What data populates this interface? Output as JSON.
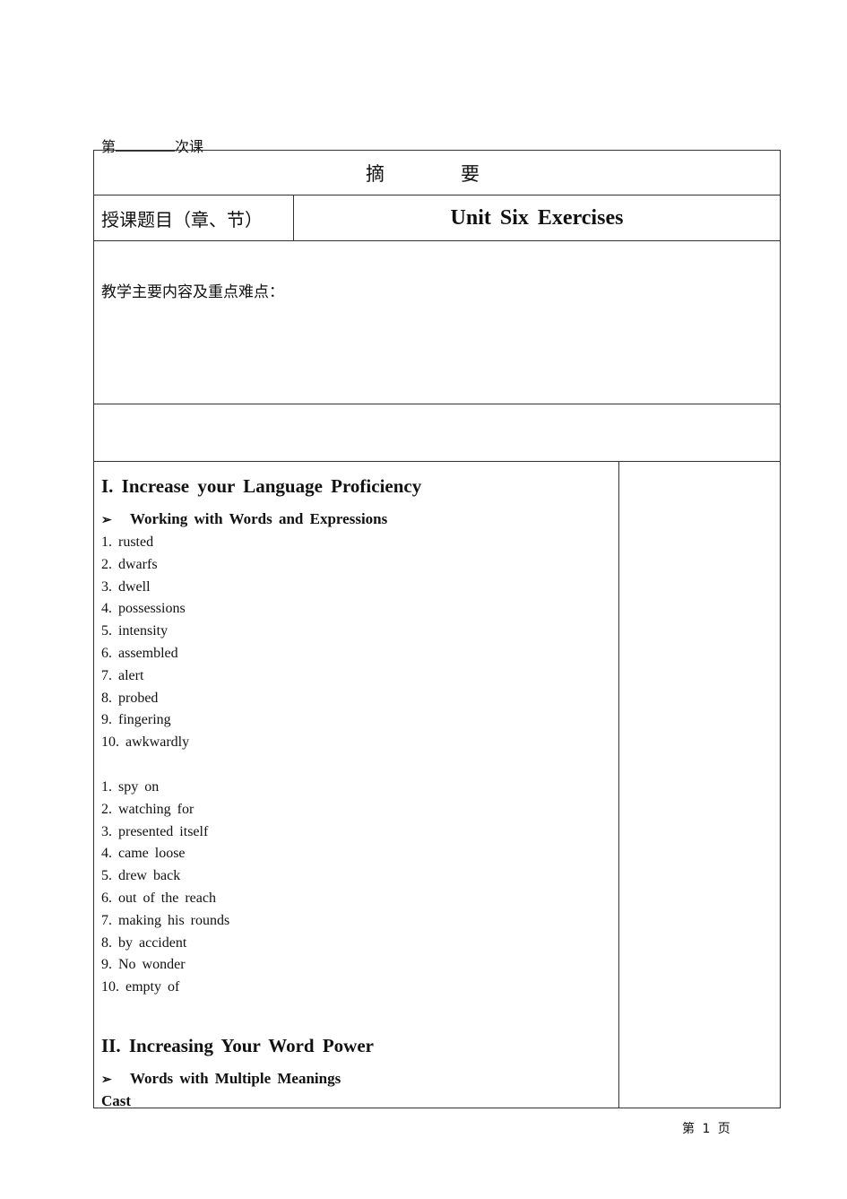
{
  "lesson": {
    "prefix": "第",
    "suffix": "次课"
  },
  "table": {
    "title": "摘　要",
    "topic_label": "授课题目（章、节）",
    "topic_value": "Unit Six Exercises",
    "content_label": "教学主要内容及重点难点："
  },
  "section1": {
    "heading": "I. Increase your Language Proficiency",
    "subheading": "Working with Words and Expressions",
    "words": [
      "1. rusted",
      "2. dwarfs",
      "3. dwell",
      "4. possessions",
      "5. intensity",
      "6. assembled",
      "7. alert",
      "8. probed",
      "9. fingering",
      "10. awkwardly"
    ],
    "expressions": [
      "1. spy on",
      "2. watching for",
      "3. presented itself",
      "4. came loose",
      "5. drew back",
      "6. out of the reach",
      "7. making his rounds",
      "8. by accident",
      "9. No wonder",
      "10. empty of"
    ]
  },
  "section2": {
    "heading": "II. Increasing Your Word Power",
    "subheading": "Words with Multiple Meanings",
    "first_word": "Cast"
  },
  "footer": {
    "page_label": "第 1 页"
  }
}
